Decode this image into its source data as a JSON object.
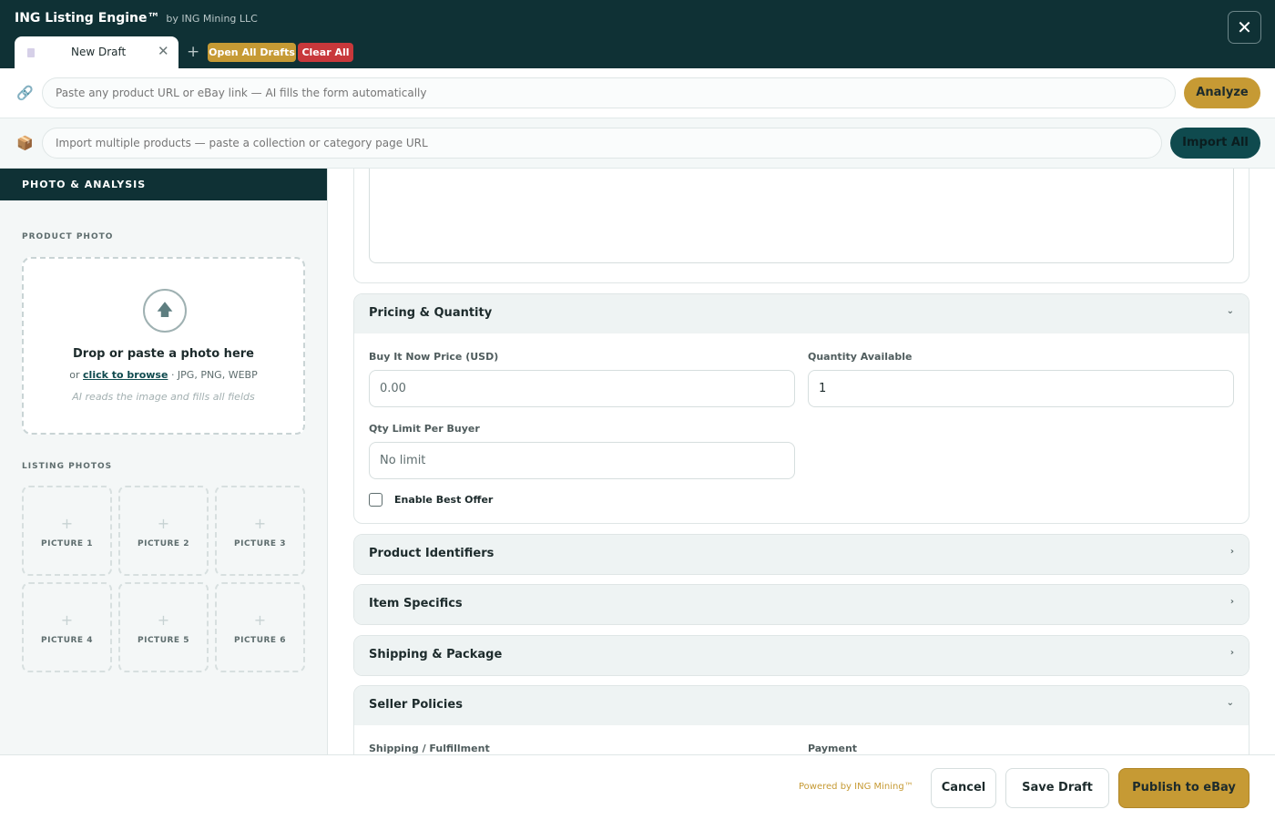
{
  "app": {
    "title": "ING Listing Engine™",
    "subtitle": "by ING Mining LLC",
    "close_icon": "close-icon"
  },
  "tabs": [
    {
      "label": "New Draft",
      "active": true
    }
  ],
  "tab_actions": {
    "add": "+",
    "open_all": "Open All Drafts",
    "clear_all": "Clear All",
    "colors": {
      "open_all": "#c69a34",
      "clear_all": "#c8383b"
    }
  },
  "url_bar": {
    "icon": "link-icon",
    "placeholder": "Paste any product URL or eBay link — AI fills the form automatically",
    "button": "Analyze"
  },
  "import_bar": {
    "icon": "package-icon",
    "placeholder": "Import multiple products — paste a collection or category page URL",
    "button": "Import All"
  },
  "left_panel": {
    "title": "PHOTO & ANALYSIS",
    "product_photo_label": "PRODUCT PHOTO",
    "dropzone": {
      "icon": "upload-arrow-icon",
      "title": "Drop or paste a photo here",
      "or": "or",
      "browse": "click to browse",
      "formats": "· JPG, PNG, WEBP",
      "note": "AI reads the image and fills all fields"
    },
    "listing_photos_label": "LISTING PHOTOS",
    "pictures": [
      "PICTURE 1",
      "PICTURE 2",
      "PICTURE 3",
      "PICTURE 4",
      "PICTURE 5",
      "PICTURE 6"
    ]
  },
  "sections": {
    "pricing": {
      "title": "Pricing & Quantity",
      "expanded": true,
      "price_label": "Buy It Now Price (USD)",
      "price_placeholder": "0.00",
      "qty_label": "Quantity Available",
      "qty_value": "1",
      "limit_label": "Qty Limit Per Buyer",
      "limit_placeholder": "No limit",
      "best_offer_label": "Enable Best Offer",
      "best_offer_checked": false
    },
    "identifiers": {
      "title": "Product Identifiers",
      "expanded": false
    },
    "specifics": {
      "title": "Item Specifics",
      "expanded": false
    },
    "shipping": {
      "title": "Shipping & Package",
      "expanded": false
    },
    "policies": {
      "title": "Seller Policies",
      "expanded": true,
      "shipping_label": "Shipping / Fulfillment",
      "payment_label": "Payment"
    }
  },
  "footer": {
    "powered": "Powered by ING Mining™",
    "cancel": "Cancel",
    "save": "Save Draft",
    "publish": "Publish to eBay"
  },
  "colors": {
    "brand_dark": "#0f3135",
    "accent_gold": "#c69a34",
    "danger": "#c8383b"
  }
}
